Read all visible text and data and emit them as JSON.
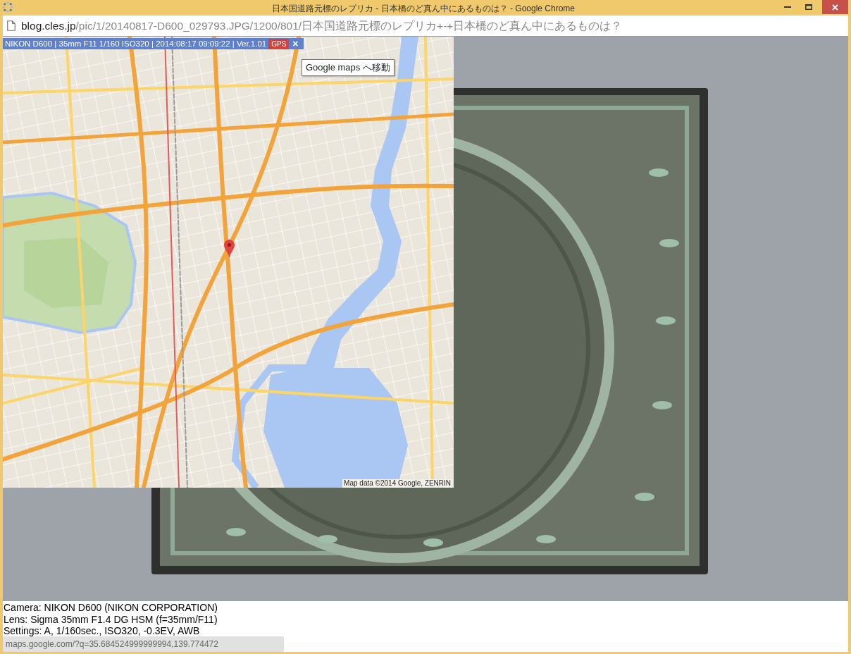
{
  "window": {
    "title": "日本国道路元標のレプリカ - 日本橋のど真ん中にあるものは？ - Google Chrome"
  },
  "address_bar": {
    "domain": "blog.cles.jp",
    "path": "/pic/1/20140817-D600_029793.JPG/1200/801/日本国道路元標のレプリカ+-+日本橋のど真ん中にあるものは？"
  },
  "map_overlay": {
    "exif_bar": "NIKON D600 | 35mm F11 1/160 ISO320 | 2014:08:17 09:09:22 | Ver.1.01",
    "gps_button": "GPS",
    "close_button": "×",
    "tooltip": "Google maps へ移動",
    "attribution": "Map data ©2014 Google, ZENRIN"
  },
  "caption": [
    "Camera: NIKON D600 (NIKON CORPORATION)",
    "Lens: Sigma 35mm F1.4 DG HSM (f=35mm/F11)",
    "Settings: A, 1/160sec., ISO320, -0.3EV, AWB"
  ],
  "status_bubble": "maps.google.com/?q=35.684524999999994,139.774472"
}
